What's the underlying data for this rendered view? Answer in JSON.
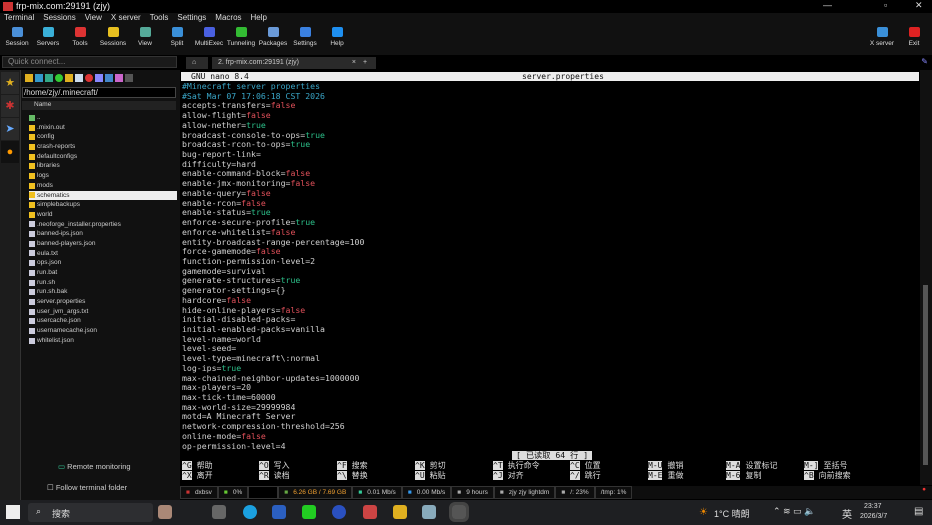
{
  "window": {
    "title": "frp-mix.com:29191 (zjy)"
  },
  "menu": [
    "Terminal",
    "Sessions",
    "View",
    "X server",
    "Tools",
    "Settings",
    "Macros",
    "Help"
  ],
  "toolbar": [
    "Session",
    "Servers",
    "Tools",
    "Sessions",
    "View",
    "Split",
    "MultiExec",
    "Tunneling",
    "Packages",
    "Settings",
    "Help"
  ],
  "toolbar_right": [
    "X server",
    "Exit"
  ],
  "quick_connect": {
    "placeholder": "Quick connect..."
  },
  "file_panel": {
    "path": "/home/zjy/.minecraft/",
    "column": "Name",
    "items": [
      [
        "..",
        "up"
      ],
      [
        ".mixin.out",
        "dir"
      ],
      [
        "config",
        "dir"
      ],
      [
        "crash-reports",
        "dir"
      ],
      [
        "defaultconfigs",
        "dir"
      ],
      [
        "libraries",
        "dir"
      ],
      [
        "logs",
        "dir"
      ],
      [
        "mods",
        "dir"
      ],
      [
        "schematics",
        "sel"
      ],
      [
        "simplebackups",
        "dir"
      ],
      [
        "world",
        "dir"
      ],
      [
        ".neoforge_installer.properties",
        "file"
      ],
      [
        "banned-ips.json",
        "file"
      ],
      [
        "banned-players.json",
        "file"
      ],
      [
        "eula.txt",
        "file"
      ],
      [
        "ops.json",
        "file"
      ],
      [
        "run.bat",
        "file"
      ],
      [
        "run.sh",
        "file"
      ],
      [
        "run.sh.bak",
        "file"
      ],
      [
        "server.properties",
        "file"
      ],
      [
        "user_jvm_args.txt",
        "file"
      ],
      [
        "usercache.json",
        "file"
      ],
      [
        "usernamecache.json",
        "file"
      ],
      [
        "whitelist.json",
        "file"
      ]
    ],
    "remote_monitoring": "Remote monitoring",
    "follow_folder": "Follow terminal folder"
  },
  "tabs": {
    "active": "2. frp-mix.com:29191 (zjy)",
    "new": "+"
  },
  "nano": {
    "version": "GNU nano 8.4",
    "filename": "server.properties",
    "status": "[ 已读取 64 行 ]",
    "lines": [
      "#Minecraft server properties",
      "#Sat Mar 07 17:06:18 CST 2026",
      "accepts-transfers=false",
      "allow-flight=false",
      "allow-nether=true",
      "broadcast-console-to-ops=true",
      "broadcast-rcon-to-ops=true",
      "bug-report-link=",
      "difficulty=hard",
      "enable-command-block=false",
      "enable-jmx-monitoring=false",
      "enable-query=false",
      "enable-rcon=false",
      "enable-status=true",
      "enforce-secure-profile=true",
      "enforce-whitelist=false",
      "entity-broadcast-range-percentage=100",
      "force-gamemode=false",
      "function-permission-level=2",
      "gamemode=survival",
      "generate-structures=true",
      "generator-settings={}",
      "hardcore=false",
      "hide-online-players=false",
      "initial-disabled-packs=",
      "initial-enabled-packs=vanilla",
      "level-name=world",
      "level-seed=",
      "level-type=minecraft\\:normal",
      "log-ips=true",
      "max-chained-neighbor-updates=1000000",
      "max-players=20",
      "max-tick-time=60000",
      "max-world-size=29999984",
      "motd=A Minecraft Server",
      "network-compression-threshold=256",
      "online-mode=false",
      "op-permission-level=4"
    ],
    "shortcuts": [
      [
        "^G",
        "帮助"
      ],
      [
        "^X",
        "离开"
      ],
      [
        "^O",
        "写入"
      ],
      [
        "^R",
        "读档"
      ],
      [
        "^F",
        "搜索"
      ],
      [
        "^\\",
        "替换"
      ],
      [
        "^K",
        "剪切"
      ],
      [
        "^U",
        "粘贴"
      ],
      [
        "^T",
        "执行命令"
      ],
      [
        "^J",
        "对齐"
      ],
      [
        "^C",
        "位置"
      ],
      [
        "^/",
        "跳行"
      ],
      [
        "M-U",
        "撤销"
      ],
      [
        "M-E",
        "重做"
      ],
      [
        "M-A",
        "设置标记"
      ],
      [
        "M-6",
        "复制"
      ],
      [
        "M-]",
        "至括号"
      ],
      [
        "^B",
        "向前搜索"
      ]
    ]
  },
  "statusbar": [
    "dxbsv",
    "0%",
    "",
    "6.26 GB / 7.69 GB",
    "0.01 Mb/s",
    "0.00 Mb/s",
    "9 hours",
    "zjy  zjy  lightdm",
    "/: 23%",
    "/tmp: 1%"
  ],
  "taskbar": {
    "search": "搜索",
    "weather": "1°C 晴朗",
    "ime": "英",
    "time": "23:37",
    "date": "2026/3/7"
  },
  "colors": {
    "true": "#2cc08a",
    "false": "#e0505a",
    "comment": "#3aa6c8"
  }
}
